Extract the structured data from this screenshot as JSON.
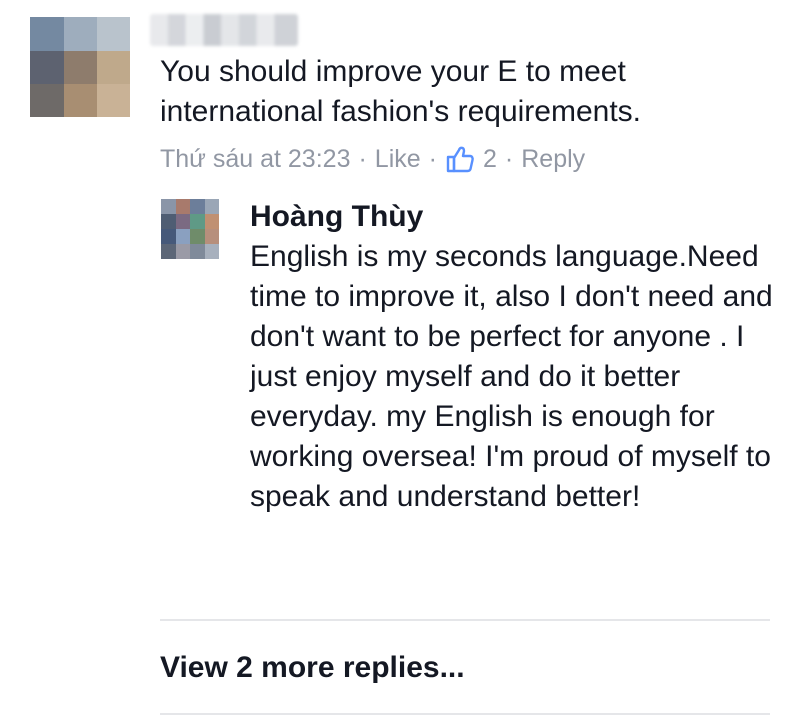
{
  "comment": {
    "text": "You should improve your E to meet international fashion's requirements.",
    "timestamp": "Thứ sáu at 23:23",
    "like_label": "Like",
    "like_count": "2",
    "reply_label": "Reply",
    "separator": "·"
  },
  "reply": {
    "author": "Hoàng Thùy",
    "text": "English is my seconds language.Need time to improve it, also I don't need and don't want to be perfect for anyone . I just enjoy myself and do it better everyday. my English is enough for working oversea! I'm proud of myself to speak and understand better!"
  },
  "view_more_label": "View 2 more replies...",
  "colors": {
    "text": "#141823",
    "meta": "#9197a3",
    "like_icon": "#5890ff",
    "divider": "#e5e6e9"
  },
  "icons": {
    "like": "thumbs-up-icon"
  }
}
